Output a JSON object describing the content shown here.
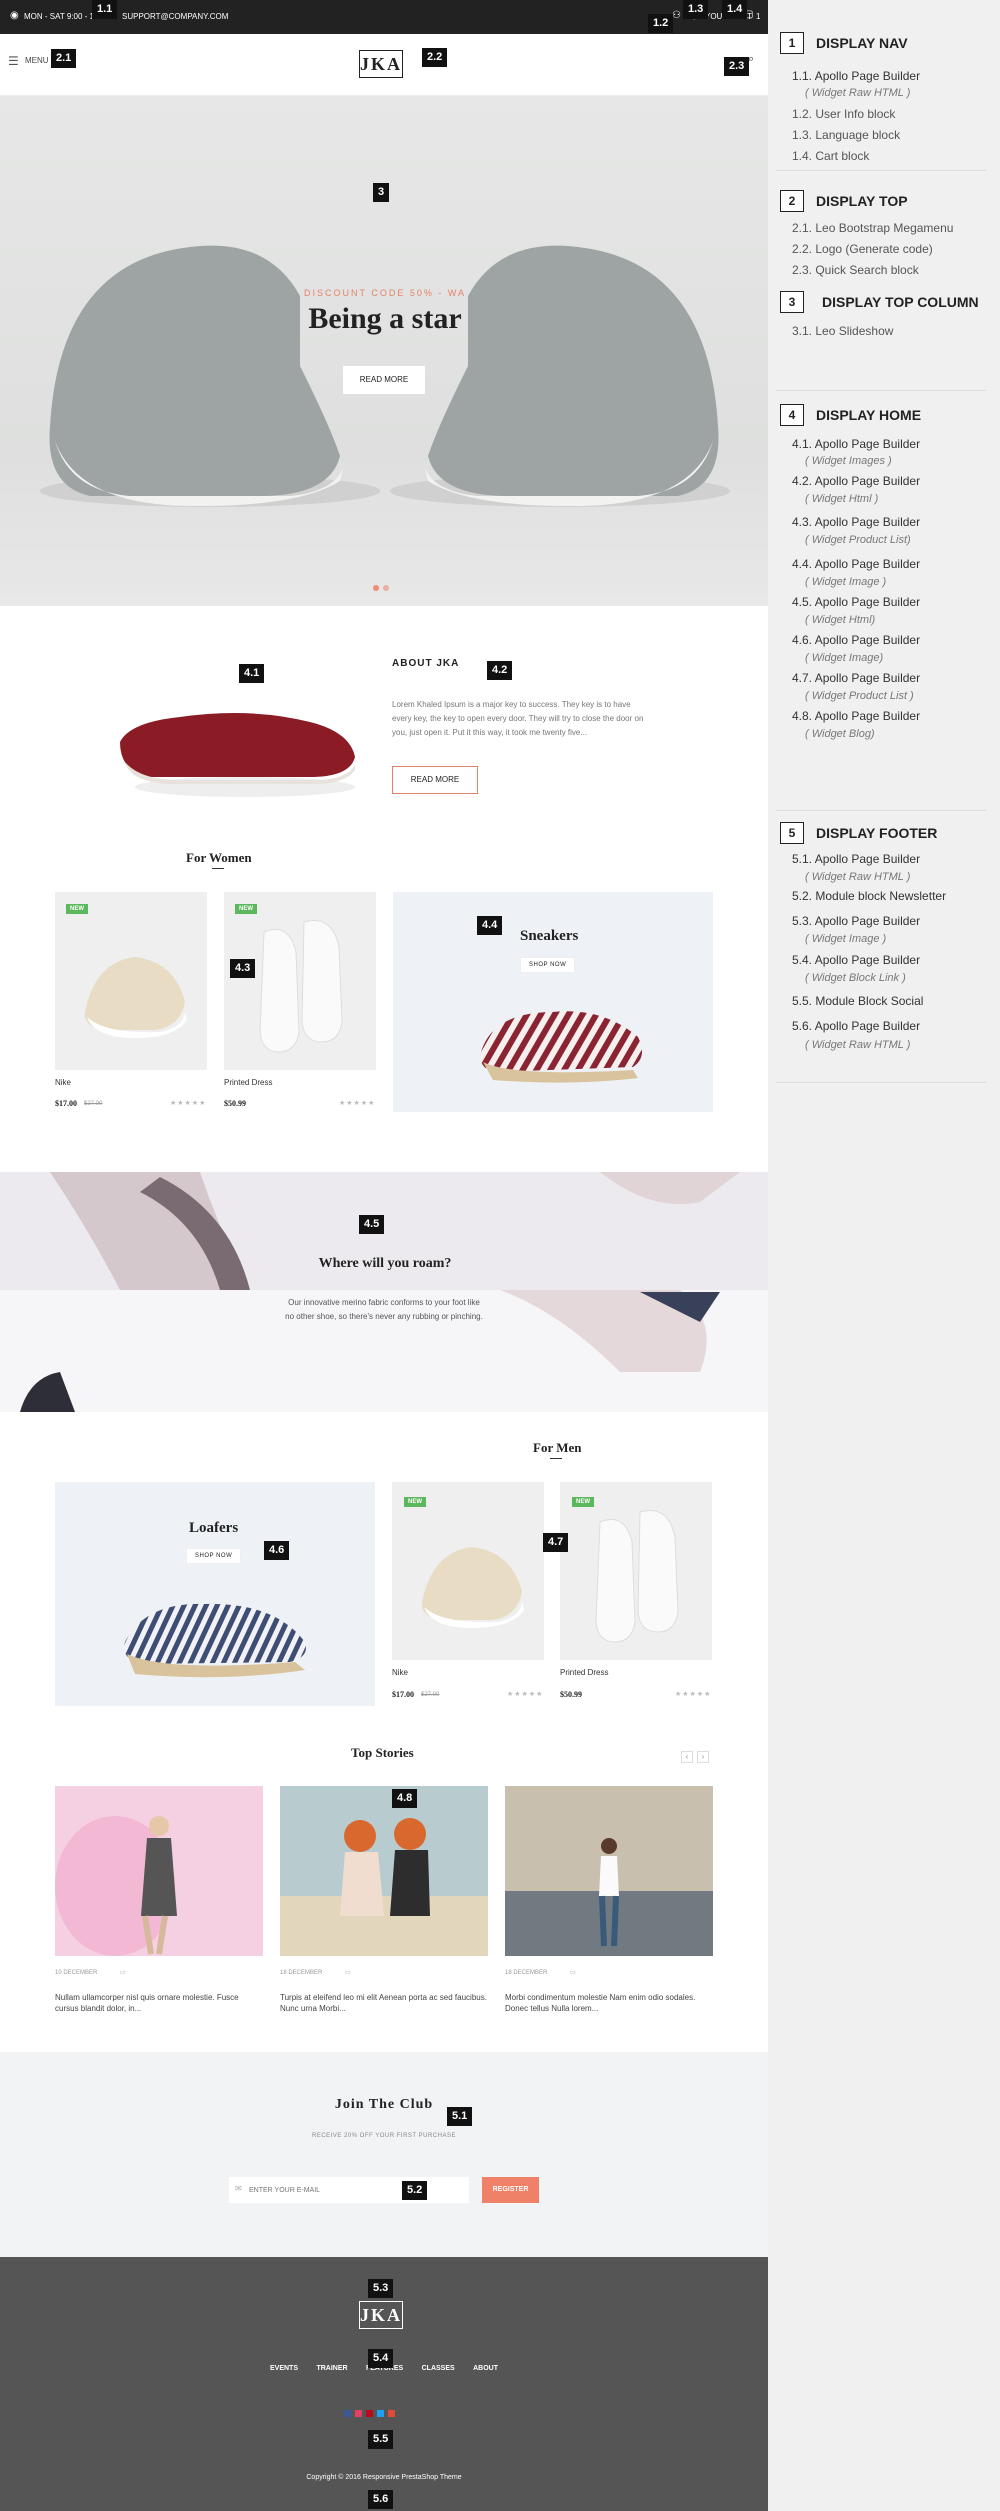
{
  "topbar": {
    "hours": "MON - SAT 9:00 - 18:00",
    "email": "SUPPORT@COMPANY.COM",
    "cart": "YOUR CART",
    "cart_count": "1"
  },
  "header": {
    "menu": "MENU",
    "logo": "JKA"
  },
  "hero": {
    "subtitle": "DISCOUNT CODE 50% - WA",
    "title": "Being a star",
    "button": "READ MORE"
  },
  "about": {
    "title": "ABOUT JKA",
    "text": "Lorem Khaled Ipsum is a major key to success. They key is to have every key, the key to open every door. They will try to close the door on you, just open it. Put it this way, it took me twenty five...",
    "button": "READ MORE"
  },
  "women": {
    "title": "For Women",
    "products": [
      {
        "badge": "NEW",
        "name": "Nike",
        "price": "$17.00",
        "old": "$27.00"
      },
      {
        "badge": "NEW",
        "name": "Printed Dress",
        "price": "$50.99",
        "old": ""
      }
    ],
    "promo": {
      "title": "Sneakers",
      "button": "SHOP NOW"
    }
  },
  "banner": {
    "title": "Where will you roam?",
    "text": "Our innovative merino fabric conforms to your foot like no other shoe, so there's never any rubbing or pinching."
  },
  "men": {
    "title": "For Men",
    "promo": {
      "title": "Loafers",
      "button": "SHOP NOW"
    },
    "products": [
      {
        "badge": "NEW",
        "name": "Nike",
        "price": "$17.00",
        "old": "$27.00"
      },
      {
        "badge": "NEW",
        "name": "Printed Dress",
        "price": "$50.99",
        "old": ""
      }
    ]
  },
  "stories": {
    "title": "Top Stories",
    "items": [
      {
        "date": "10 DECEMBER",
        "text": "Nullam ullamcorper nisl quis ornare molestie. Fusce cursus blandit dolor, in..."
      },
      {
        "date": "18 DECEMBER",
        "text": "Turpis at eleifend leo mi elit Aenean porta ac sed faucibus. Nunc urna Morbi..."
      },
      {
        "date": "18 DECEMBER",
        "text": "Morbi condimentum molestie Nam enim odio sodales. Donec tellus Nulla lorem..."
      }
    ]
  },
  "newsletter": {
    "title": "Join The Club",
    "subtitle": "RECEIVE 20% OFF YOUR FIRST PURCHASE",
    "placeholder": "ENTER YOUR E-MAIL",
    "button": "REGISTER"
  },
  "footer": {
    "logo": "JKA",
    "links": [
      "EVENTS",
      "TRAINER",
      "FEATURES",
      "CLASSES",
      "ABOUT"
    ],
    "copyright": "Copyright © 2016 Responsive PrestaShop Theme"
  },
  "markers": {
    "m11": "1.1",
    "m12": "1.2",
    "m13": "1.3",
    "m14": "1.4",
    "m21": "2.1",
    "m22": "2.2",
    "m23": "2.3",
    "m3": "3",
    "m41": "4.1",
    "m42": "4.2",
    "m43": "4.3",
    "m44": "4.4",
    "m45": "4.5",
    "m46": "4.6",
    "m47": "4.7",
    "m48": "4.8",
    "m51": "5.1",
    "m52": "5.2",
    "m53": "5.3",
    "m54": "5.4",
    "m55": "5.5",
    "m56": "5.6"
  },
  "legend": [
    {
      "num": "1",
      "title": "DISPLAY NAV",
      "items": [
        {
          "text": "1.1. Apollo Page Builder",
          "sub": "( Widget Raw HTML )"
        },
        {
          "text": "1.2. User Info block",
          "sub": ""
        },
        {
          "text": "1.3. Language block",
          "sub": ""
        },
        {
          "text": "1.4. Cart block",
          "sub": ""
        }
      ]
    },
    {
      "num": "2",
      "title": "DISPLAY TOP",
      "items": [
        {
          "text": "2.1. Leo Bootstrap Megamenu",
          "sub": ""
        },
        {
          "text": "2.2. Logo (Generate code)",
          "sub": ""
        },
        {
          "text": "2.3. Quick Search block",
          "sub": ""
        }
      ]
    },
    {
      "num": "3",
      "title": "DISPLAY TOP COLUMN",
      "items": [
        {
          "text": "3.1. Leo Slideshow",
          "sub": ""
        }
      ]
    },
    {
      "num": "4",
      "title": "DISPLAY HOME",
      "items": [
        {
          "text": "4.1. Apollo Page Builder",
          "sub": "( Widget Images )"
        },
        {
          "text": "4.2. Apollo Page Builder",
          "sub": "( Widget Html )"
        },
        {
          "text": "4.3. Apollo Page Builder",
          "sub": "( Widget Product List)"
        },
        {
          "text": "4.4. Apollo Page Builder",
          "sub": "( Widget Image )"
        },
        {
          "text": "4.5. Apollo Page Builder",
          "sub": "( Widget Html)"
        },
        {
          "text": "4.6. Apollo Page Builder",
          "sub": "( Widget Image)"
        },
        {
          "text": "4.7. Apollo Page Builder",
          "sub": "( Widget Product  List )"
        },
        {
          "text": "4.8. Apollo Page Builder",
          "sub": "( Widget Blog)"
        }
      ]
    },
    {
      "num": "5",
      "title": "DISPLAY FOOTER",
      "items": [
        {
          "text": "5.1. Apollo Page Builder",
          "sub": "( Widget Raw HTML )"
        },
        {
          "text": "5.2. Module block Newsletter",
          "sub": ""
        },
        {
          "text": "5.3. Apollo Page Builder",
          "sub": "( Widget Image )"
        },
        {
          "text": "5.4. Apollo Page Builder",
          "sub": "( Widget Block Link )"
        },
        {
          "text": "5.5. Module Block Social",
          "sub": ""
        },
        {
          "text": "5.6. Apollo Page Builder",
          "sub": "( Widget Raw HTML )"
        }
      ]
    }
  ]
}
